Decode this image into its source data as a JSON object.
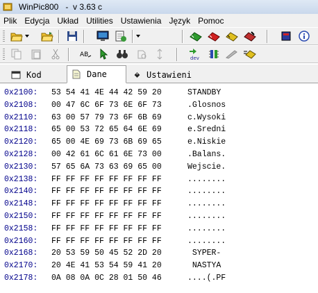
{
  "window": {
    "title": "WinPic800   -  v 3.63 c"
  },
  "menu": [
    "Plik",
    "Edycja",
    "Układ",
    "Utilities",
    "Ustawienia",
    "Język",
    "Pomoc"
  ],
  "tabs": [
    {
      "label": "Kod",
      "icon": "code-icon",
      "active": false
    },
    {
      "label": "Dane",
      "icon": "data-icon",
      "active": true
    },
    {
      "label": "Ustawieni",
      "icon": "settings-tag-icon",
      "active": false
    }
  ],
  "colors": {
    "address": "#00008b",
    "titlebar": "#dfe9f5"
  },
  "hex_rows": [
    {
      "addr": "0x2100:",
      "bytes": "53 54 41 4E 44 42 59 20",
      "ascii": "STANDBY "
    },
    {
      "addr": "0x2108:",
      "bytes": "00 47 6C 6F 73 6E 6F 73",
      "ascii": ".Glosnos"
    },
    {
      "addr": "0x2110:",
      "bytes": "63 00 57 79 73 6F 6B 69",
      "ascii": "c.Wysoki"
    },
    {
      "addr": "0x2118:",
      "bytes": "65 00 53 72 65 64 6E 69",
      "ascii": "e.Sredni"
    },
    {
      "addr": "0x2120:",
      "bytes": "65 00 4E 69 73 6B 69 65",
      "ascii": "e.Niskie"
    },
    {
      "addr": "0x2128:",
      "bytes": "00 42 61 6C 61 6E 73 00",
      "ascii": ".Balans."
    },
    {
      "addr": "0x2130:",
      "bytes": "57 65 6A 73 63 69 65 00",
      "ascii": "Wejscie."
    },
    {
      "addr": "0x2138:",
      "bytes": "FF FF FF FF FF FF FF FF",
      "ascii": "........"
    },
    {
      "addr": "0x2140:",
      "bytes": "FF FF FF FF FF FF FF FF",
      "ascii": "........"
    },
    {
      "addr": "0x2148:",
      "bytes": "FF FF FF FF FF FF FF FF",
      "ascii": "........"
    },
    {
      "addr": "0x2150:",
      "bytes": "FF FF FF FF FF FF FF FF",
      "ascii": "........"
    },
    {
      "addr": "0x2158:",
      "bytes": "FF FF FF FF FF FF FF FF",
      "ascii": "........"
    },
    {
      "addr": "0x2160:",
      "bytes": "FF FF FF FF FF FF FF FF",
      "ascii": "........"
    },
    {
      "addr": "0x2168:",
      "bytes": "20 53 59 50 45 52 2D 20",
      "ascii": " SYPER- "
    },
    {
      "addr": "0x2170:",
      "bytes": "20 4E 41 53 54 59 41 20",
      "ascii": " NASTYA "
    },
    {
      "addr": "0x2178:",
      "bytes": "0A 08 0A 0C 28 01 50 46",
      "ascii": "....(.PF"
    }
  ]
}
